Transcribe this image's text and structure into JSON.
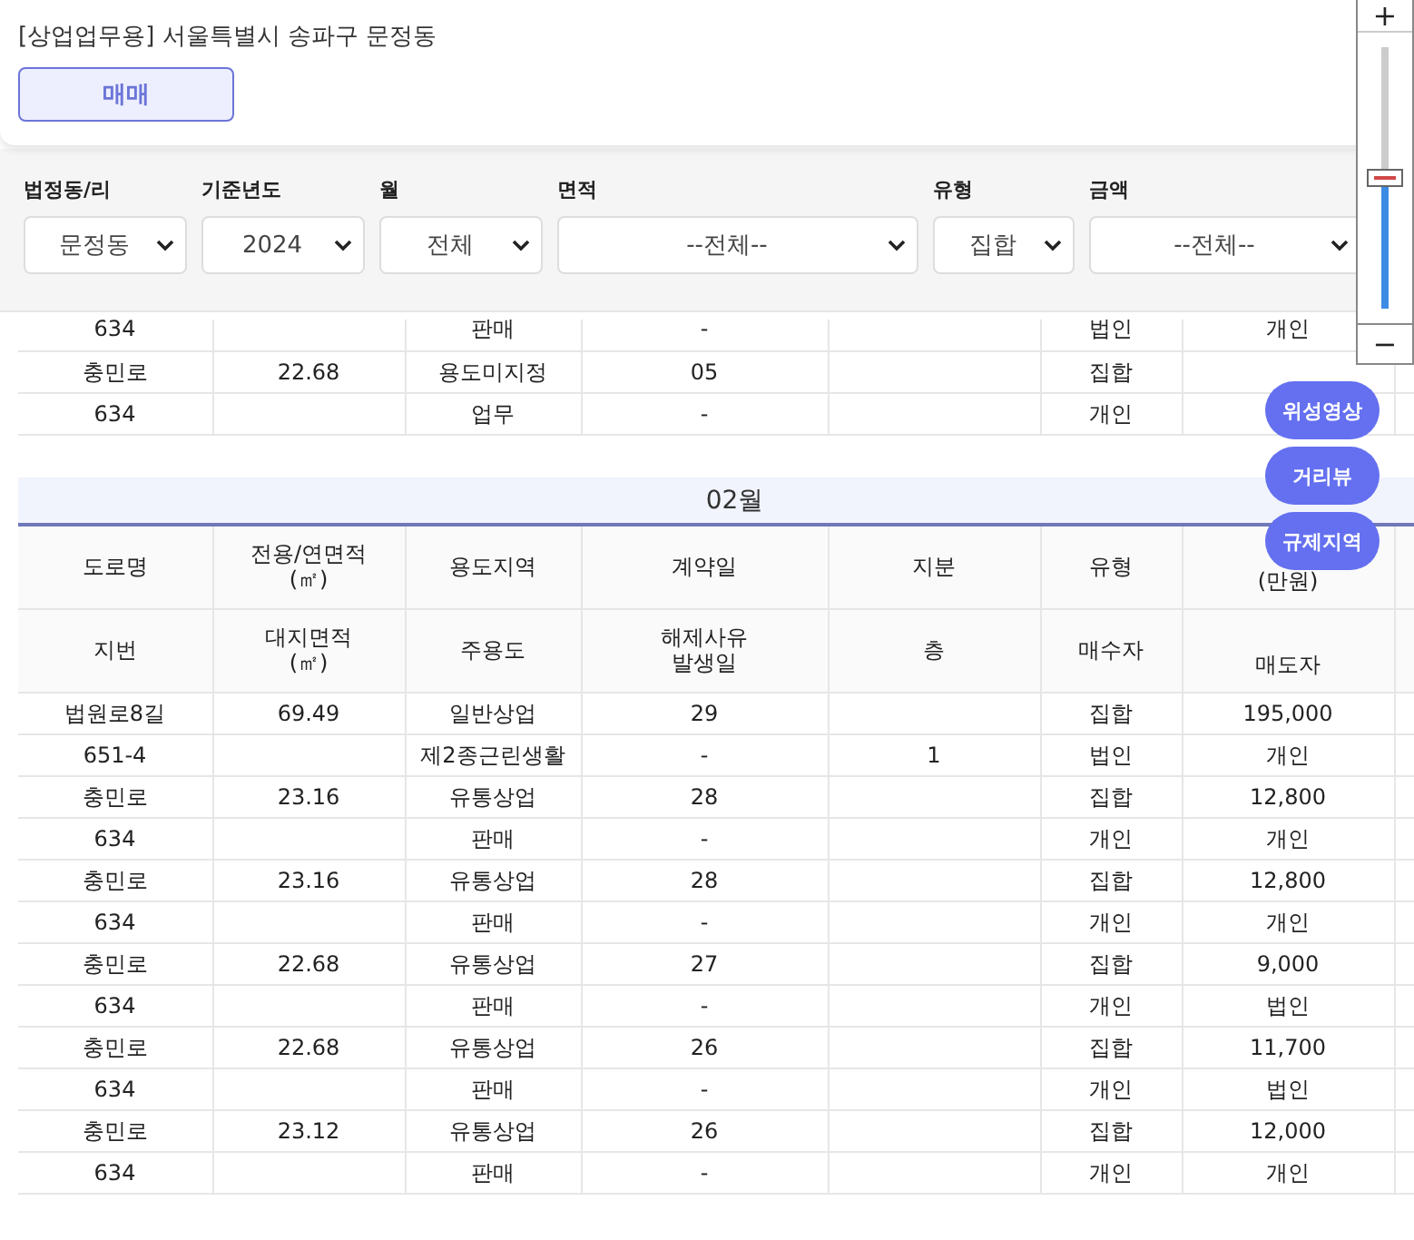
{
  "header": {
    "title": "[상업업무용] 서울특별시 송파구 문정동",
    "tabs": [
      {
        "label": "매매",
        "selected": true
      }
    ]
  },
  "filters": [
    {
      "label": "법정동/리",
      "value": "문정동"
    },
    {
      "label": "기준년도",
      "value": "2024"
    },
    {
      "label": "월",
      "value": "전체"
    },
    {
      "label": "면적",
      "value": "--전체--"
    },
    {
      "label": "유형",
      "value": "집합"
    },
    {
      "label": "금액",
      "value": "--전체--"
    }
  ],
  "zoom_control": {
    "zoom_in": "+",
    "zoom_out": "−",
    "level": 0.5
  },
  "map_buttons": [
    "위성영상",
    "거리뷰",
    "규제지역"
  ],
  "table": {
    "top_rows": [
      [
        "634",
        null,
        "판매",
        "-",
        null,
        "법인",
        "개인"
      ],
      [
        "충민로",
        "22.68",
        "용도미지정",
        "05",
        null,
        "집합",
        null
      ],
      [
        "634",
        null,
        "업무",
        "-",
        null,
        "개인",
        null
      ]
    ],
    "months": [
      {
        "title": "02월",
        "header_rows": [
          [
            "도로명",
            "전용/연면적\n(㎡)",
            "용도지역",
            "계약일",
            "지분",
            "유형",
            "(만원)"
          ],
          [
            "지번",
            "대지면적\n(㎡)",
            "주용도",
            "해제사유\n발생일",
            "층",
            "매수자",
            "매도자"
          ]
        ],
        "rows": [
          [
            "법원로8길",
            "69.49",
            "일반상업",
            "29",
            null,
            "집합",
            "195,000"
          ],
          [
            "651-4",
            null,
            "제2종근린생활",
            "-",
            "1",
            "법인",
            "개인"
          ],
          [
            "충민로",
            "23.16",
            "유통상업",
            "28",
            null,
            "집합",
            "12,800"
          ],
          [
            "634",
            null,
            "판매",
            "-",
            null,
            "개인",
            "개인"
          ],
          [
            "충민로",
            "23.16",
            "유통상업",
            "28",
            null,
            "집합",
            "12,800"
          ],
          [
            "634",
            null,
            "판매",
            "-",
            null,
            "개인",
            "개인"
          ],
          [
            "충민로",
            "22.68",
            "유통상업",
            "27",
            null,
            "집합",
            "9,000"
          ],
          [
            "634",
            null,
            "판매",
            "-",
            null,
            "개인",
            "법인"
          ],
          [
            "충민로",
            "22.68",
            "유통상업",
            "26",
            null,
            "집합",
            "11,700"
          ],
          [
            "634",
            null,
            "판매",
            "-",
            null,
            "개인",
            "법인"
          ],
          [
            "충민로",
            "23.12",
            "유통상업",
            "26",
            null,
            "집합",
            "12,000"
          ],
          [
            "634",
            null,
            "판매",
            "-",
            null,
            "개인",
            "개인"
          ]
        ]
      }
    ]
  }
}
